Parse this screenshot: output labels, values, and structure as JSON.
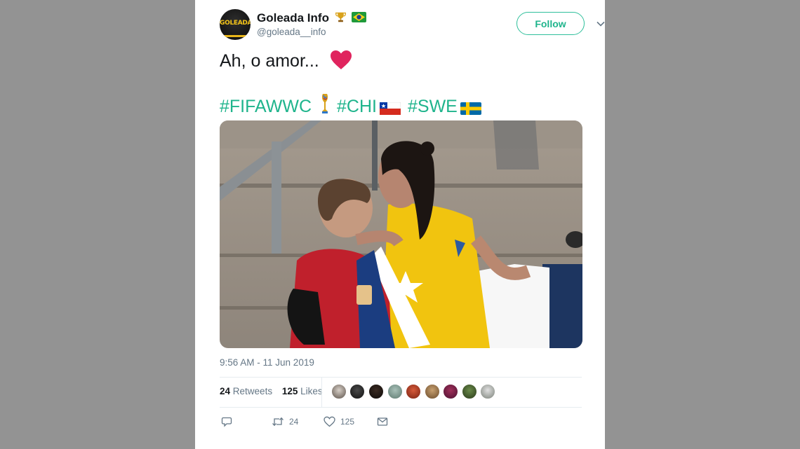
{
  "tweet": {
    "author": {
      "name": "Goleada Info",
      "handle": "@goleada__info",
      "avatar_text": "GOLEADA",
      "badges": [
        "trophy-emoji",
        "brazil-flag-emoji"
      ]
    },
    "follow_label": "Follow",
    "text": "Ah, o amor...",
    "text_emoji": "red-heart",
    "hashtags": [
      "#FIFAWWC",
      "#CHI",
      "#SWE"
    ],
    "hashtag_emojis": [
      "womens-world-cup-trophy",
      "chile-flag",
      "sweden-flag"
    ],
    "timestamp": "9:56 AM - 11 Jun 2019",
    "retweets_count": "24",
    "retweets_label": "Retweets",
    "likes_count": "125",
    "likes_label": "Likes",
    "liker_avatar_count": 9,
    "actions": {
      "reply_icon": "reply-icon",
      "retweet_count": "24",
      "like_count": "125",
      "dm_icon": "envelope-icon"
    }
  },
  "colors": {
    "background": "#939393",
    "accent": "#1fb48c",
    "text": "#14171a",
    "secondary": "#657786",
    "heart": "#e0245e"
  }
}
